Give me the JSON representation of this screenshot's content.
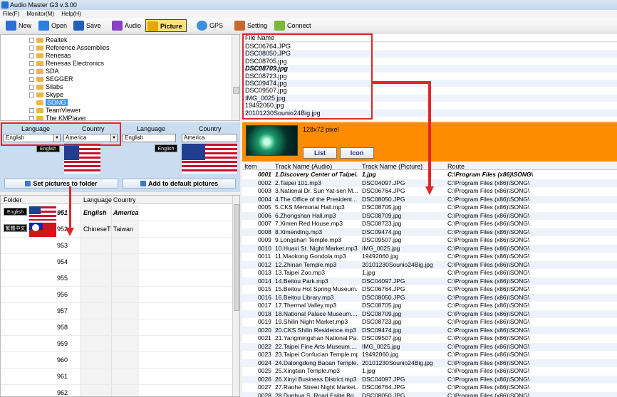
{
  "window": {
    "title": "Audio Master G3 v.3.00"
  },
  "menu": [
    "File(F)",
    "Monitor(M)",
    "Help(H)"
  ],
  "toolbar": {
    "new": "New",
    "open": "Open",
    "save": "Save",
    "audio": "Audio",
    "picture": "Picture",
    "gps": "GPS",
    "setting": "Setting",
    "connect": "Connect"
  },
  "tree": {
    "items": [
      "Realtek",
      "Reference Assemblies",
      "Renesas",
      "Renesas Electronics",
      "SDA",
      "SEGGER",
      "Silabs",
      "Skype",
      "SONG",
      "TeamViewer",
      "The KMPlayer"
    ],
    "selected": "SONG"
  },
  "file_panel": {
    "header": "File Name",
    "files": [
      "DSC06764.JPG",
      "DSC08050.JPG",
      "DSC08705.jpg",
      "DSC08709.jpg",
      "DSC08723.jpg",
      "DSC09474.jpg",
      "DSC09507.jpg",
      "IMG_0025.jpg",
      "19492060.jpg",
      "20101230Sounio24Big.jpg"
    ],
    "bold_file": "DSC08709.jpg"
  },
  "lang_panel": {
    "language_label": "Language",
    "country_label": "Country",
    "left": {
      "language": "English",
      "country": "America",
      "badge": "English"
    },
    "right": {
      "language": "English",
      "country": "America",
      "badge": "English"
    },
    "set_button": "Set pictures to folder",
    "add_button": "Add to default pictures"
  },
  "folder_table": {
    "headers": {
      "folder": "Folder",
      "language": "Language",
      "country": "Country"
    },
    "rows": [
      {
        "num": "951",
        "language": "English",
        "country": "America",
        "badge": "English",
        "flag": "us"
      },
      {
        "num": "952",
        "language": "ChineseT",
        "country": "Taiwan",
        "badge": "繁體中文",
        "flag": "tw"
      },
      {
        "num": "953"
      },
      {
        "num": "954"
      },
      {
        "num": "955"
      },
      {
        "num": "956"
      },
      {
        "num": "957"
      },
      {
        "num": "958"
      },
      {
        "num": "959"
      },
      {
        "num": "960"
      },
      {
        "num": "961"
      },
      {
        "num": "962"
      }
    ]
  },
  "preview": {
    "pixel_info": "128x72 pixel",
    "list_button": "List",
    "icon_button": "Icon"
  },
  "track_table": {
    "headers": {
      "item": "Item",
      "audio": "Track Name (Audio)",
      "picture": "Track Name (Picture)",
      "route": "Route"
    },
    "rows": [
      [
        "0001",
        "1.Discovery Center of Taipei...",
        "1.jpg",
        "C:\\Program Files (x86)\\SONG\\"
      ],
      [
        "0002",
        "2.Taipei 101.mp3",
        "DSC04097.JPG",
        "C:\\Program Files (x86)\\SONG\\"
      ],
      [
        "0003",
        "3.National Dr. Sun Yat-sen M...",
        "DSC06764.JPG",
        "C:\\Program Files (x86)\\SONG\\"
      ],
      [
        "0004",
        "4.The Office of the President....",
        "DSC08050.JPG",
        "C:\\Program Files (x86)\\SONG\\"
      ],
      [
        "0005",
        "5.CKS Memorial Hall.mp3",
        "DSC08705.jpg",
        "C:\\Program Files (x86)\\SONG\\"
      ],
      [
        "0006",
        "6.Zhongshan Hall.mp3",
        "DSC08709.jpg",
        "C:\\Program Files (x86)\\SONG\\"
      ],
      [
        "0007",
        "7.Ximen Red House.mp3",
        "DSC08723.jpg",
        "C:\\Program Files (x86)\\SONG\\"
      ],
      [
        "0008",
        "8.Ximending.mp3",
        "DSC09474.jpg",
        "C:\\Program Files (x86)\\SONG\\"
      ],
      [
        "0009",
        "9.Longshan Temple.mp3",
        "DSC09507.jpg",
        "C:\\Program Files (x86)\\SONG\\"
      ],
      [
        "0010",
        "10.Huaxi St. Night Market.mp3",
        "IMG_0025.jpg",
        "C:\\Program Files (x86)\\SONG\\"
      ],
      [
        "0011",
        "11.Maokong Gondola.mp3",
        "19492060.jpg",
        "C:\\Program Files (x86)\\SONG\\"
      ],
      [
        "0012",
        "12.Zhinan Temple.mp3",
        "20101230Sounio24Big.jpg",
        "C:\\Program Files (x86)\\SONG\\"
      ],
      [
        "0013",
        "13.Taipei Zoo.mp3",
        "1.jpg",
        "C:\\Program Files (x86)\\SONG\\"
      ],
      [
        "0014",
        "14.Beitou Park.mp3",
        "DSC04097.JPG",
        "C:\\Program Files (x86)\\SONG\\"
      ],
      [
        "0015",
        "15.Beitou Hot Spring Museum...",
        "DSC06764.JPG",
        "C:\\Program Files (x86)\\SONG\\"
      ],
      [
        "0016",
        "16.Beitou Library.mp3",
        "DSC08050.JPG",
        "C:\\Program Files (x86)\\SONG\\"
      ],
      [
        "0017",
        "17.Thermal Valley.mp3",
        "DSC08705.jpg",
        "C:\\Program Files (x86)\\SONG\\"
      ],
      [
        "0018",
        "18.National Palace Museum....",
        "DSC08709.jpg",
        "C:\\Program Files (x86)\\SONG\\"
      ],
      [
        "0019",
        "19.Shilin Night Market.mp3",
        "DSC08723.jpg",
        "C:\\Program Files (x86)\\SONG\\"
      ],
      [
        "0020",
        "20.CKS Shilin Residence.mp3",
        "DSC09474.jpg",
        "C:\\Program Files (x86)\\SONG\\"
      ],
      [
        "0021",
        "21.Yangmingshan National Pa...",
        "DSC09507.jpg",
        "C:\\Program Files (x86)\\SONG\\"
      ],
      [
        "0022",
        "22.Taipei Fine Arts Museum....",
        "IMG_0025.jpg",
        "C:\\Program Files (x86)\\SONG\\"
      ],
      [
        "0023",
        "23.Taipei Confucian Temple.mp3",
        "19492060.jpg",
        "C:\\Program Files (x86)\\SONG\\"
      ],
      [
        "0024",
        "24.Dalongdong Baoan Temple...",
        "20101230Sounio24Big.jpg",
        "C:\\Program Files (x86)\\SONG\\"
      ],
      [
        "0025",
        "25.Xingtian Temple.mp3",
        "1.jpg",
        "C:\\Program Files (x86)\\SONG\\"
      ],
      [
        "0026",
        "26.Xinyi Business District.mp3",
        "DSC04097.JPG",
        "C:\\Program Files (x86)\\SONG\\"
      ],
      [
        "0027",
        "27.Raohe Street Night Market...",
        "DSC06764.JPG",
        "C:\\Program Files (x86)\\SONG\\"
      ],
      [
        "0028",
        "28.Dunhua S. Road Eslite Bo...",
        "DSC08050.JPG",
        "C:\\Program Files (x86)\\SONG\\"
      ]
    ]
  },
  "colors": {
    "accent_red": "#e0262d",
    "preview_orange": "#ff8c00",
    "panel_blue": "#c9dcf0",
    "selection_blue": "#3399ff"
  },
  "icons": [
    "new-icon",
    "open-icon",
    "save-icon",
    "audio-icon",
    "picture-icon",
    "gps-icon",
    "setting-icon",
    "connect-icon"
  ]
}
